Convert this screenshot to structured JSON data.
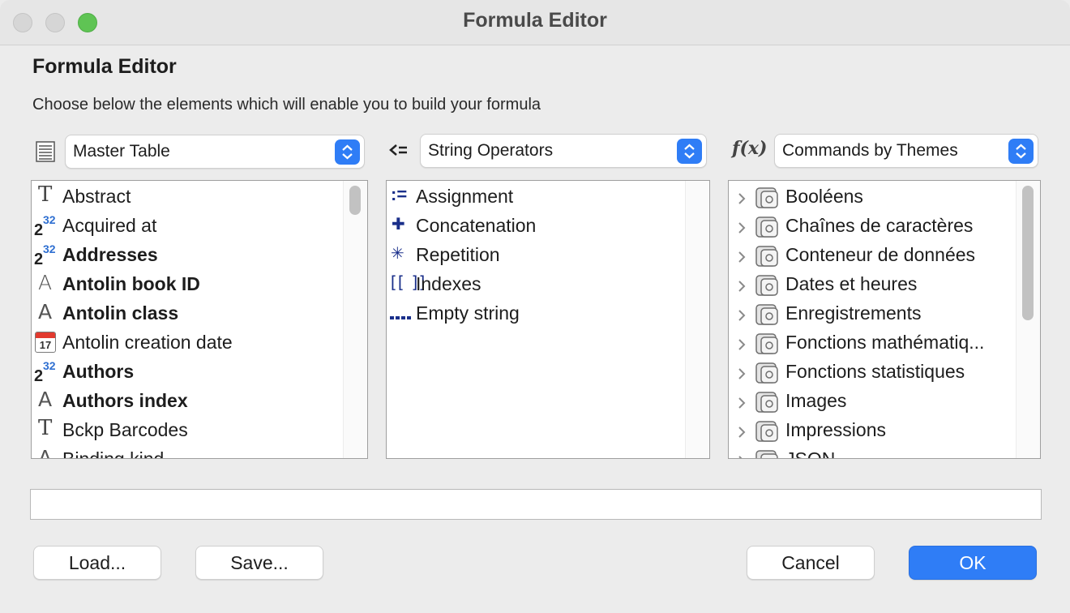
{
  "window": {
    "title": "Formula Editor",
    "colors": {
      "accent": "#2f7df6",
      "zoom": "#5fc454"
    }
  },
  "heading": "Formula Editor",
  "subtitle": "Choose below the elements which will enable you to build your formula",
  "tables_popup": {
    "selected": "Master Table",
    "icon": "table-icon"
  },
  "operators_popup": {
    "selected": "String Operators",
    "icon": "assign-operator-icon"
  },
  "commands_popup": {
    "selected": "Commands by Themes",
    "icon": "function-fx-icon",
    "icon_text": "f(x)"
  },
  "fields": [
    {
      "label": "Abstract",
      "bold": false,
      "icon": "text-field-icon"
    },
    {
      "label": "Acquired at",
      "bold": false,
      "icon": "integer-field-icon"
    },
    {
      "label": "Addresses",
      "bold": true,
      "icon": "integer-field-icon"
    },
    {
      "label": "Antolin book ID",
      "bold": true,
      "icon": "alpha-field-icon"
    },
    {
      "label": "Antolin class",
      "bold": true,
      "icon": "alpha-field-icon"
    },
    {
      "label": "Antolin creation date",
      "bold": false,
      "icon": "date-field-icon",
      "icon_text": "17"
    },
    {
      "label": "Authors",
      "bold": true,
      "icon": "integer-field-icon"
    },
    {
      "label": "Authors index",
      "bold": true,
      "icon": "alpha-field-icon"
    },
    {
      "label": "Bckp Barcodes",
      "bold": false,
      "icon": "text-field-icon"
    },
    {
      "label": "Binding kind",
      "bold": false,
      "icon": "alpha-field-icon"
    }
  ],
  "operators": [
    {
      "label": "Assignment",
      "icon": "assignment-icon",
      "icon_text": ":="
    },
    {
      "label": "Concatenation",
      "icon": "plus-icon",
      "icon_text": "✚"
    },
    {
      "label": "Repetition",
      "icon": "asterisk-icon",
      "icon_text": "✳"
    },
    {
      "label": "Indexes",
      "icon": "brackets-icon",
      "icon_text": "[[ ]]"
    },
    {
      "label": "Empty string",
      "icon": "empty-string-icon",
      "icon_text": "\"\""
    }
  ],
  "themes": [
    {
      "label": "Booléens"
    },
    {
      "label": "Chaînes de caractères"
    },
    {
      "label": "Conteneur de données"
    },
    {
      "label": "Dates et heures"
    },
    {
      "label": "Enregistrements"
    },
    {
      "label": "Fonctions mathématiq..."
    },
    {
      "label": "Fonctions statistiques"
    },
    {
      "label": "Images"
    },
    {
      "label": "Impressions"
    },
    {
      "label": "JSON"
    }
  ],
  "formula": {
    "value": ""
  },
  "buttons": {
    "load": "Load...",
    "save": "Save...",
    "cancel": "Cancel",
    "ok": "OK"
  },
  "icon_texts": {
    "integer_base": "2",
    "integer_exp": "32",
    "text_glyph": "T",
    "alpha_glyph": "A"
  }
}
